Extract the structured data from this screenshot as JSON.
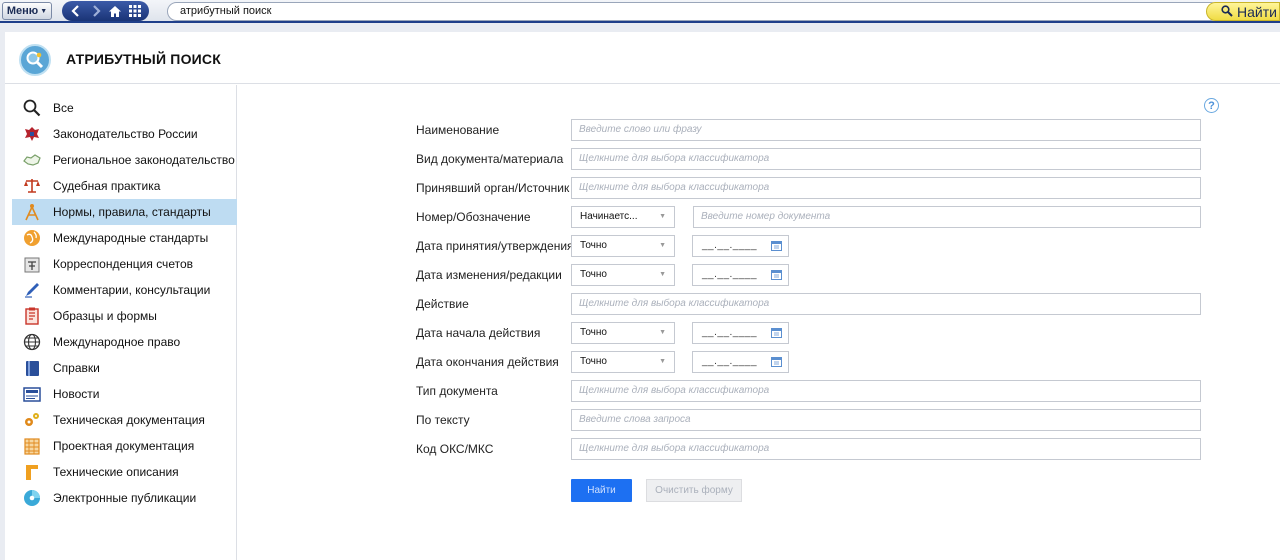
{
  "topbar": {
    "menu_label": "Меню",
    "search_value": "атрибутный поиск",
    "find_label": "Найти"
  },
  "header": {
    "title": "АТРИБУТНЫЙ ПОИСК"
  },
  "sidebar": {
    "items": [
      {
        "label": "Все",
        "icon": "search-icon"
      },
      {
        "label": "Законодательство России",
        "icon": "russia-emblem-icon"
      },
      {
        "label": "Региональное законодательство",
        "icon": "region-map-icon"
      },
      {
        "label": "Судебная практика",
        "icon": "scales-icon"
      },
      {
        "label": "Нормы, правила, стандарты",
        "icon": "compass-icon",
        "active": true
      },
      {
        "label": "Международные стандарты",
        "icon": "globe-orange-icon"
      },
      {
        "label": "Корреспонденция счетов",
        "icon": "accounts-icon"
      },
      {
        "label": "Комментарии, консультации",
        "icon": "pen-icon"
      },
      {
        "label": "Образцы и формы",
        "icon": "forms-icon"
      },
      {
        "label": "Международное право",
        "icon": "globe-grid-icon"
      },
      {
        "label": "Справки",
        "icon": "book-icon"
      },
      {
        "label": "Новости",
        "icon": "news-icon"
      },
      {
        "label": "Техническая документация",
        "icon": "gears-icon"
      },
      {
        "label": "Проектная документация",
        "icon": "grid-icon"
      },
      {
        "label": "Технические описания",
        "icon": "ruler-icon"
      },
      {
        "label": "Электронные публикации",
        "icon": "disc-icon"
      }
    ]
  },
  "form": {
    "fields": [
      {
        "label": "Наименование",
        "placeholder": "Введите слово или фразу"
      },
      {
        "label": "Вид документа/материала",
        "placeholder": "Щелкните для выбора классификатора"
      },
      {
        "label": "Принявший орган/Источник",
        "placeholder": "Щелкните для выбора классификатора"
      },
      {
        "label": "Номер/Обозначение",
        "select": "Начинаетс...",
        "placeholder": "Введите номер документа"
      },
      {
        "label": "Дата принятия/утверждения",
        "select": "Точно",
        "date": "__.__.____"
      },
      {
        "label": "Дата изменения/редакции",
        "select": "Точно",
        "date": "__.__.____"
      },
      {
        "label": "Действие",
        "placeholder": "Щелкните для выбора классификатора"
      },
      {
        "label": "Дата начала действия",
        "select": "Точно",
        "date": "__.__.____"
      },
      {
        "label": "Дата окончания действия",
        "select": "Точно",
        "date": "__.__.____"
      },
      {
        "label": "Тип документа",
        "placeholder": "Щелкните для выбора классификатора"
      },
      {
        "label": "По тексту",
        "placeholder": "Введите слова запроса"
      },
      {
        "label": "Код ОКС/МКС",
        "placeholder": "Щелкните для выбора классификатора"
      }
    ],
    "help_label": "?",
    "submit_label": "Найти",
    "clear_label": "Очистить форму"
  },
  "colors": {
    "accent": "#1d70f2",
    "active_item": "#bedcf2",
    "find_button": "#f0dc45",
    "topbar_border": "#1f3f8a"
  }
}
